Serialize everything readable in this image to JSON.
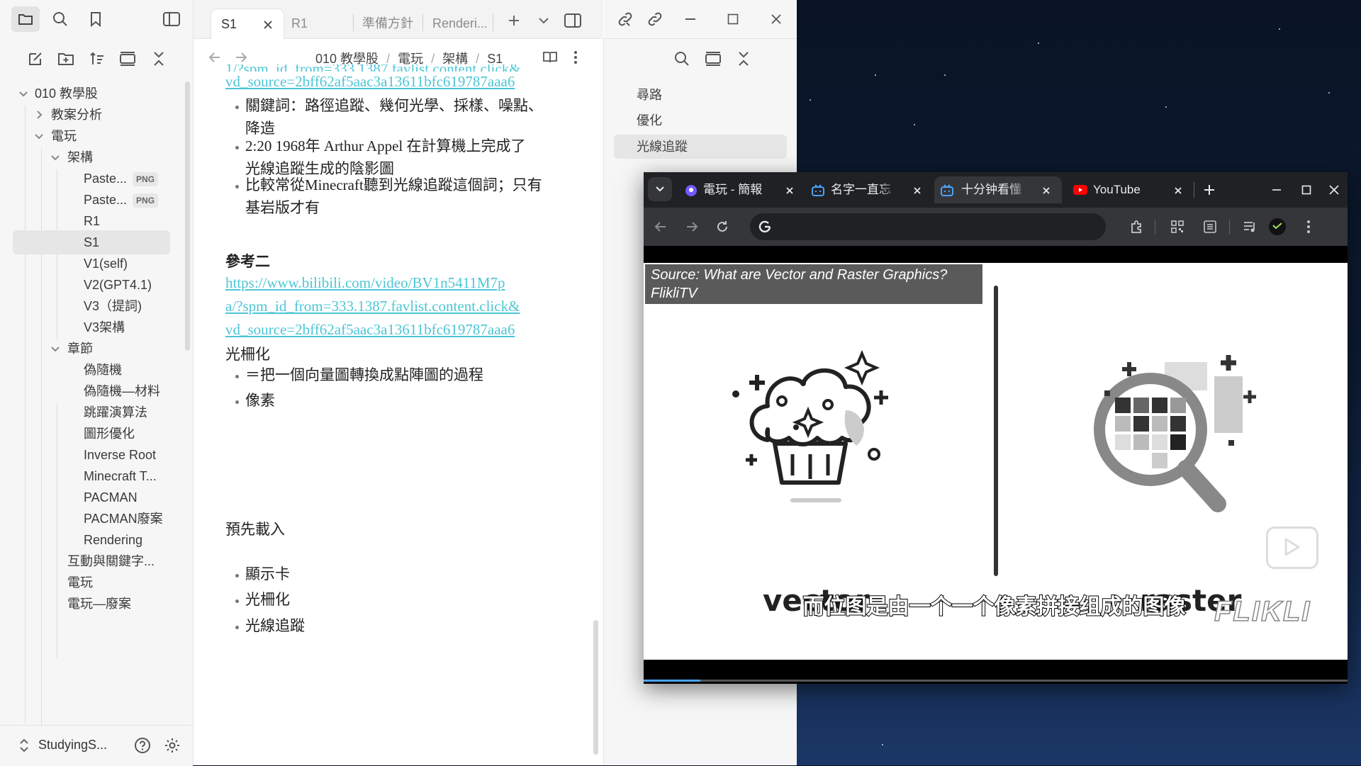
{
  "obsidian": {
    "vault_name": "StudyingS...",
    "explorer": {
      "items": [
        {
          "label": "010 教學股",
          "level": 0,
          "type": "folder",
          "expanded": true
        },
        {
          "label": "教案分析",
          "level": 1,
          "type": "folder",
          "expanded": false
        },
        {
          "label": "電玩",
          "level": 1,
          "type": "folder",
          "expanded": true
        },
        {
          "label": "架構",
          "level": 2,
          "type": "folder",
          "expanded": true
        },
        {
          "label": "Paste...",
          "level": 3,
          "type": "file",
          "badge": "PNG"
        },
        {
          "label": "Paste...",
          "level": 3,
          "type": "file",
          "badge": "PNG"
        },
        {
          "label": "R1",
          "level": 3,
          "type": "file"
        },
        {
          "label": "S1",
          "level": 3,
          "type": "file",
          "active": true
        },
        {
          "label": "V1(self)",
          "level": 3,
          "type": "file"
        },
        {
          "label": "V2(GPT4.1)",
          "level": 3,
          "type": "file"
        },
        {
          "label": "V3（提詞)",
          "level": 3,
          "type": "file"
        },
        {
          "label": "V3架構",
          "level": 3,
          "type": "file"
        },
        {
          "label": "章節",
          "level": 2,
          "type": "folder",
          "expanded": true
        },
        {
          "label": "偽隨機",
          "level": 3,
          "type": "file"
        },
        {
          "label": "偽隨機—材料",
          "level": 3,
          "type": "file"
        },
        {
          "label": "跳躍演算法",
          "level": 3,
          "type": "file"
        },
        {
          "label": "圖形優化",
          "level": 3,
          "type": "file"
        },
        {
          "label": "Inverse Root",
          "level": 3,
          "type": "file"
        },
        {
          "label": "Minecraft T...",
          "level": 3,
          "type": "file"
        },
        {
          "label": "PACMAN",
          "level": 3,
          "type": "file"
        },
        {
          "label": "PACMAN廢案",
          "level": 3,
          "type": "file"
        },
        {
          "label": "Rendering",
          "level": 3,
          "type": "file"
        },
        {
          "label": "互動與關鍵字...",
          "level": 2,
          "type": "file"
        },
        {
          "label": "電玩",
          "level": 2,
          "type": "file"
        },
        {
          "label": "電玩—廢案",
          "level": 2,
          "type": "file"
        }
      ]
    },
    "tabs": [
      "S1",
      "R1",
      "準備方針",
      "Renderi..."
    ],
    "breadcrumb": [
      "010 教學股",
      "電玩",
      "架構",
      "S1"
    ],
    "note": {
      "top_link_partial_1": "1/?spm_id_from=333.1387.favlist.content.click&",
      "top_link_partial_2": "vd_source=2bff62af5aac3a13611bfc619787aaa6",
      "bullets_1": [
        "關鍵詞：路徑追蹤、幾何光學、採樣、噪點、",
        "降造",
        "2:20 1968年 Arthur Appel 在計算機上完成了",
        "光線追蹤生成的陰影圖",
        "比較常從Minecraft聽到光線追蹤這個詞；只有",
        "基岩版才有"
      ],
      "ref2_heading": "參考二",
      "ref2_link_1": "https://www.bilibili.com/video/BV1n5411M7p",
      "ref2_link_2": "a/?spm_id_from=333.1387.favlist.content.click&",
      "ref2_link_3": "vd_source=2bff62af5aac3a13611bfc619787aaa6",
      "raster_heading": "光柵化",
      "raster_bullets": [
        "＝把一個向量圖轉換成點陣圖的過程",
        "像素"
      ],
      "preload_heading": "預先載入",
      "preload_bullets": [
        "顯示卡",
        "光柵化",
        "光線追蹤"
      ]
    },
    "outline": {
      "items": [
        "尋路",
        "優化",
        "光線追蹤"
      ],
      "active_index": 2
    }
  },
  "browser": {
    "tabs": [
      {
        "title": "電玩 - 簡報",
        "favicon": "slides-icon"
      },
      {
        "title": "名字一直忘",
        "favicon": "bilibili-icon"
      },
      {
        "title": "十分钟看懂",
        "favicon": "bilibili-icon",
        "active": true
      },
      {
        "title": "YouTube",
        "favicon": "youtube-icon"
      }
    ],
    "address": "",
    "video": {
      "source_label_1": "Source: What are Vector and Raster Graphics?",
      "source_label_2": "FlikliTV",
      "vector_label": "vector",
      "raster_label": "raster",
      "watermark": "FLIKLI",
      "subtitle": "而位图是由一个一个像素拼接组成的图像"
    }
  }
}
